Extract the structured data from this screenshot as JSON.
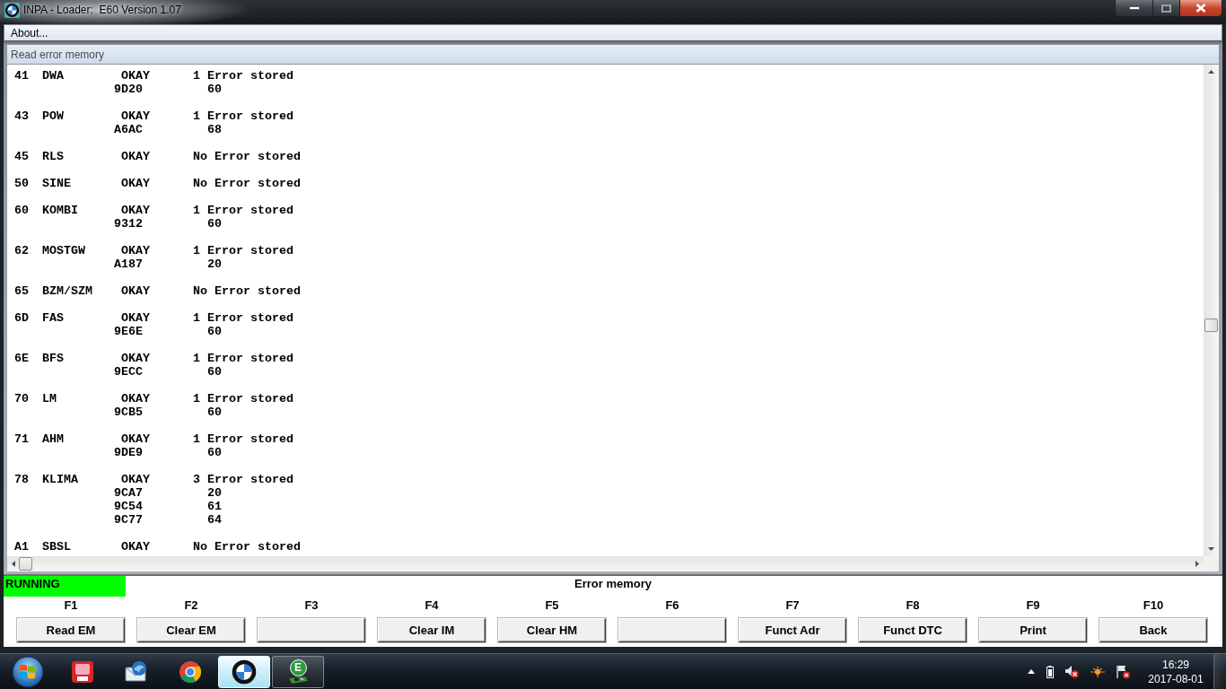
{
  "window": {
    "title": "INPA - Loader:  E60 Version 1.07"
  },
  "menu": [
    {
      "label": "About..."
    }
  ],
  "panel": {
    "title": "Read error memory",
    "rows": [
      {
        "address": "41",
        "module": "DWA",
        "status": "OKAY",
        "summary": "1 Error stored",
        "codes": [
          {
            "code": "9D20",
            "value": "60"
          }
        ]
      },
      {
        "address": "43",
        "module": "POW",
        "status": "OKAY",
        "summary": "1 Error stored",
        "codes": [
          {
            "code": "A6AC",
            "value": "68"
          }
        ]
      },
      {
        "address": "45",
        "module": "RLS",
        "status": "OKAY",
        "summary": "No Error stored"
      },
      {
        "address": "50",
        "module": "SINE",
        "status": "OKAY",
        "summary": "No Error stored"
      },
      {
        "address": "60",
        "module": "KOMBI",
        "status": "OKAY",
        "summary": "1 Error stored",
        "codes": [
          {
            "code": "9312",
            "value": "60"
          }
        ]
      },
      {
        "address": "62",
        "module": "MOSTGW",
        "status": "OKAY",
        "summary": "1 Error stored",
        "codes": [
          {
            "code": "A187",
            "value": "20"
          }
        ]
      },
      {
        "address": "65",
        "module": "BZM/SZM",
        "status": "OKAY",
        "summary": "No Error stored"
      },
      {
        "address": "6D",
        "module": "FAS",
        "status": "OKAY",
        "summary": "1 Error stored",
        "codes": [
          {
            "code": "9E6E",
            "value": "60"
          }
        ]
      },
      {
        "address": "6E",
        "module": "BFS",
        "status": "OKAY",
        "summary": "1 Error stored",
        "codes": [
          {
            "code": "9ECC",
            "value": "60"
          }
        ]
      },
      {
        "address": "70",
        "module": "LM",
        "status": "OKAY",
        "summary": "1 Error stored",
        "codes": [
          {
            "code": "9CB5",
            "value": "60"
          }
        ]
      },
      {
        "address": "71",
        "module": "AHM",
        "status": "OKAY",
        "summary": "1 Error stored",
        "codes": [
          {
            "code": "9DE9",
            "value": "60"
          }
        ]
      },
      {
        "address": "78",
        "module": "KLIMA",
        "status": "OKAY",
        "summary": "3 Error stored",
        "codes": [
          {
            "code": "9CA7",
            "value": "20"
          },
          {
            "code": "9C54",
            "value": "61"
          },
          {
            "code": "9C77",
            "value": "64"
          }
        ]
      },
      {
        "address": "A1",
        "module": "SBSL",
        "status": "OKAY",
        "summary": "No Error stored"
      }
    ]
  },
  "status": {
    "state": "RUNNING",
    "title": "Error memory"
  },
  "function_keys": [
    {
      "key": "F1",
      "label": "Read EM"
    },
    {
      "key": "F2",
      "label": "Clear EM"
    },
    {
      "key": "F3"
    },
    {
      "key": "F4",
      "label": "Clear IM"
    },
    {
      "key": "F5",
      "label": "Clear HM"
    },
    {
      "key": "F6"
    },
    {
      "key": "F7",
      "label": "Funct Adr"
    },
    {
      "key": "F8",
      "label": "Funct DTC"
    },
    {
      "key": "F9",
      "label": "Print"
    },
    {
      "key": "F10",
      "label": "Back"
    }
  ],
  "taskbar": {
    "apps": [
      {
        "kind": "document",
        "running": false,
        "selected": false
      },
      {
        "kind": "mail",
        "running": false,
        "selected": false
      },
      {
        "kind": "browser",
        "running": false,
        "selected": false
      },
      {
        "kind": "roundel",
        "running": true,
        "selected": true
      },
      {
        "kind": "letter",
        "letter": "E",
        "running": true,
        "selected": false
      }
    ],
    "clock": {
      "time": "16:29",
      "date": "2017-08-01"
    }
  }
}
